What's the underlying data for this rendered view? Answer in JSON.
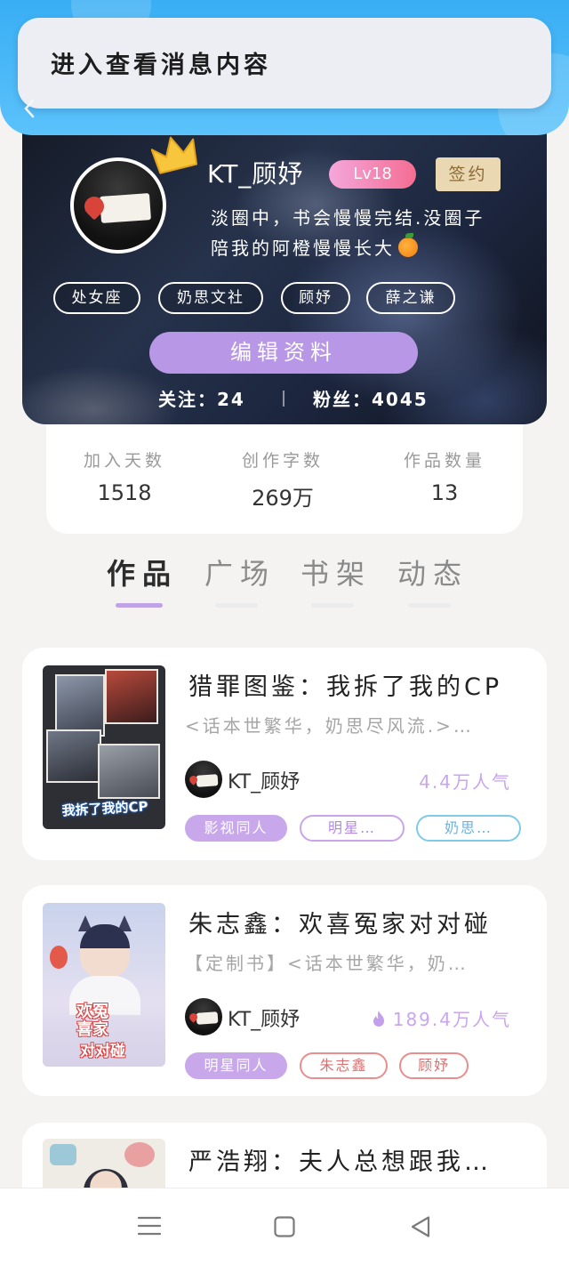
{
  "notification": {
    "text": "进入查看消息内容",
    "back_icon": "chevron-left-icon"
  },
  "profile": {
    "username": "KT_顾妤",
    "level": "Lv18",
    "badge": "签约",
    "bio": [
      "淡圈中，书会慢慢完结.没圈子",
      "陪我的阿橙慢慢长大"
    ],
    "bio_emoji_icon": "orange-icon",
    "crown_icon": "crown-icon",
    "tags": [
      "处女座",
      "奶思文社",
      "顾妤",
      "薛之谦"
    ],
    "edit_button": "编辑资料",
    "following": {
      "label": "关注：",
      "value": "24"
    },
    "followers": {
      "label": "粉丝：",
      "value": "4045"
    }
  },
  "stats": [
    {
      "label": "加入天数",
      "value": "1518"
    },
    {
      "label": "创作字数",
      "value": "269万"
    },
    {
      "label": "作品数量",
      "value": "13"
    }
  ],
  "tabs": [
    {
      "label": "作品",
      "active": true
    },
    {
      "label": "广场",
      "active": false
    },
    {
      "label": "书架",
      "active": false
    },
    {
      "label": "动态",
      "active": false
    }
  ],
  "works": [
    {
      "title": "猎罪图鉴：我拆了我的CP",
      "summary": "<话本世繁华，奶思尽风流.>…",
      "author": "KT_顾妤",
      "popularity": "4.4万人气",
      "hot": false,
      "cover_caption": "我拆了我的CP",
      "tags": [
        {
          "label": "影视同人",
          "style": "filled"
        },
        {
          "label": "明星…",
          "style": "outline-purple"
        },
        {
          "label": "奶思…",
          "style": "outline-blue"
        }
      ]
    },
    {
      "title": "朱志鑫：欢喜冤家对对碰",
      "summary": "【定制书】<话本世繁华，奶…",
      "author": "KT_顾妤",
      "popularity": "189.4万人气",
      "hot": true,
      "hot_icon": "flame-icon",
      "cover_caption": [
        "欢冤",
        "喜家",
        "对对碰"
      ],
      "tags": [
        {
          "label": "明星同人",
          "style": "filled"
        },
        {
          "label": "朱志鑫",
          "style": "outline-red"
        },
        {
          "label": "顾妤",
          "style": "outline-red"
        }
      ]
    },
    {
      "title": "严浩翔：夫人总想跟我…"
    }
  ],
  "nav": {
    "icons": [
      "menu-icon",
      "home-square-icon",
      "back-triangle-icon"
    ]
  },
  "colors": {
    "banner_blue": "#39aef4",
    "accent_purple": "#b898e6",
    "level_gradient": [
      "#f4a7dc",
      "#f46d93"
    ],
    "sign_badge": "#e9d8b1",
    "popularity": "#c9a5ec",
    "tag_blue": "#7fcbe6",
    "tag_red": "#e98d8d"
  }
}
